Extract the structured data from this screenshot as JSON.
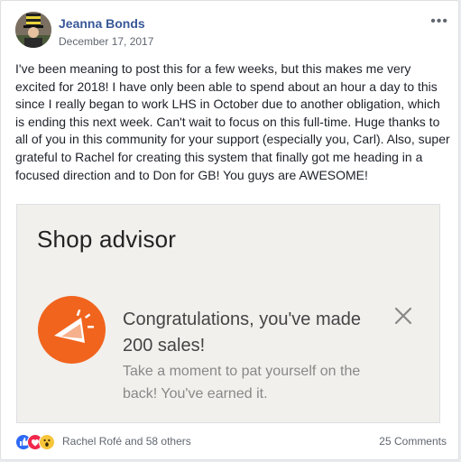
{
  "post": {
    "author": "Jeanna Bonds",
    "date": "December 17, 2017",
    "text": "I've been meaning to post this for a few weeks, but this makes me very excited for 2018! I have only been able to spend about an hour a day to this since I really began to work LHS in October due to another obligation, which is ending this next week. Can't wait to focus on this full-time. Huge thanks to all of you in this community for your support (especially you, Carl). Also, super grateful to Rachel for creating this system that finally got me heading in a focused direction and to Don for GB! You guys are AWESOME!",
    "more_icon": "•••"
  },
  "shared_image": {
    "title": "Shop advisor",
    "promo_title": "Congratulations, you've made 200 sales!",
    "promo_subtitle": "Take a moment to pat yourself on the back! You've earned it.",
    "icon": "party-popper-icon",
    "accent": "#f1641e"
  },
  "footer": {
    "reaction_icons": [
      "like-icon",
      "love-icon",
      "wow-icon"
    ],
    "reacted_by": "Rachel Rofé and 58 others",
    "comments": "25 Comments"
  },
  "colors": {
    "link": "#385898",
    "secondary_text": "#616770",
    "card_bg": "#ffffff",
    "page_bg": "#e9ebee"
  }
}
